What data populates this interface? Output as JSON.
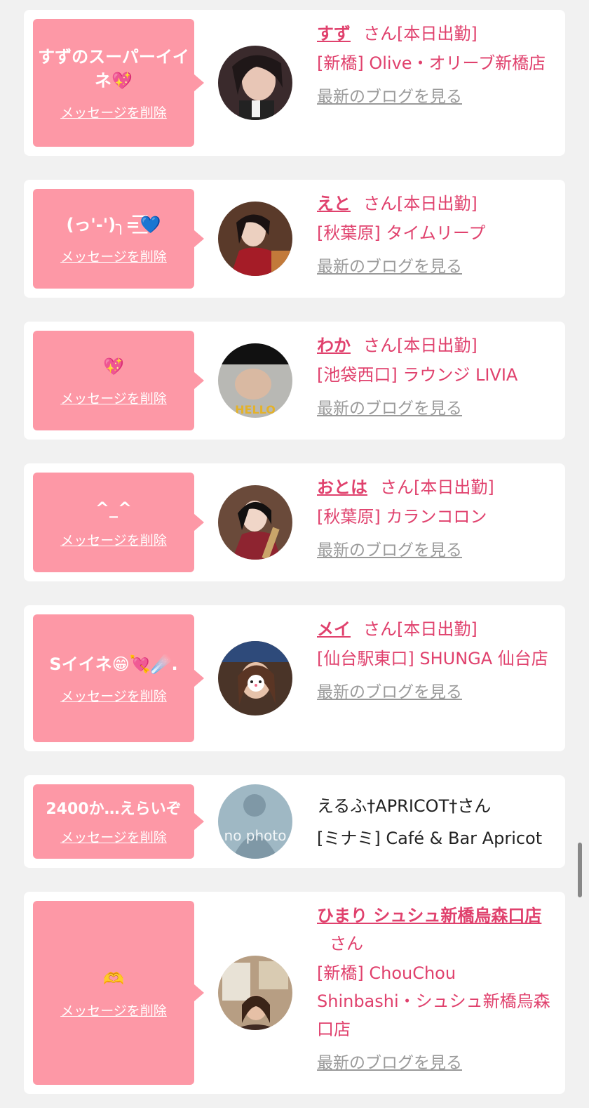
{
  "delete_label": "メッセージを削除",
  "blog_label": "最新のブログを見る",
  "cards": [
    {
      "message": "すずのスーパーイイネ💖",
      "name": "すず",
      "san": "さん[本日出勤]",
      "shop": "[新橋] Olive・オリーブ新橋店"
    },
    {
      "message": "(っ'-')╮=͟͟͞͞💙",
      "name": "えと",
      "san": "さん[本日出勤]",
      "shop": "[秋葉原] タイムリープ"
    },
    {
      "message": "💖",
      "name": "わか",
      "san": "さん[本日出勤]",
      "shop": "[池袋西口] ラウンジ LIVIA"
    },
    {
      "message": "^_^",
      "name": "おとは",
      "san": "さん[本日出勤]",
      "shop": "[秋葉原] カランコロン"
    },
    {
      "message": "Sイイネ😁💘☄️.",
      "name": "メイ",
      "san": "さん[本日出勤]",
      "shop": "[仙台駅東口] SHUNGA 仙台店"
    },
    {
      "message": "2400か…えらいぞ",
      "name": "えるふ†APRICOT†さん",
      "shop": "[ミナミ] Café & Bar Apricot"
    },
    {
      "message": "🫶",
      "name": "ひまり シュシュ新橋烏森口店",
      "san": "さん",
      "shop": "[新橋] ChouChou Shinbashi・シュシュ新橋烏森口店"
    }
  ],
  "avatar_texts": {
    "no_photo": "no photo",
    "hello": "HELLO"
  },
  "colors": {
    "accent": "#e0416d",
    "bubble": "#fd98a6",
    "background": "#f1f1f1"
  }
}
